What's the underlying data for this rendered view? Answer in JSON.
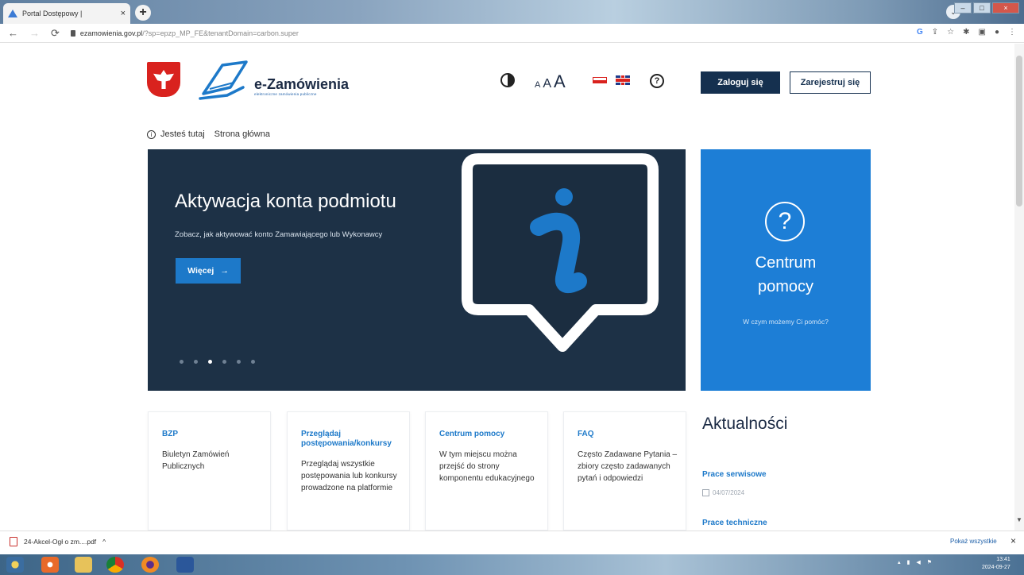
{
  "browser": {
    "tab_title": "Portal Dostępowy |",
    "tab_close": "×",
    "new_tab": "+",
    "url_host": "ezamowienia.gov.pl",
    "url_path": "/?sp=epzp_MP_FE&tenantDomain=carbon.super",
    "win_min": "–",
    "win_max": "□",
    "win_close": "×"
  },
  "header": {
    "brand_name": "e-Zamówienia",
    "brand_tagline": "elektroniczne zamówienia publiczne",
    "font_small": "A",
    "font_medium": "A",
    "font_large": "A",
    "help_glyph": "?",
    "login_label": "Zaloguj się",
    "register_label": "Zarejestruj się"
  },
  "breadcrumb": {
    "info_glyph": "i",
    "prefix": "Jesteś tutaj",
    "current": "Strona główna"
  },
  "hero": {
    "title": "Aktywacja konta podmiotu",
    "subtitle": "Zobacz, jak aktywować konto Zamawiającego lub Wykonawcy",
    "button_label": "Więcej",
    "button_arrow": "→",
    "slides": 6,
    "active_slide": 3
  },
  "help_center": {
    "glyph": "?",
    "title_line1": "Centrum",
    "title_line2": "pomocy",
    "subtitle": "W czym możemy Ci pomóc?"
  },
  "cards": [
    {
      "title": "BZP",
      "desc": "Biuletyn Zamówień Publicznych"
    },
    {
      "title": "Przeglądaj postępowania/konkursy",
      "desc": "Przeglądaj wszystkie postępowania lub konkursy prowadzone na platformie"
    },
    {
      "title": "Centrum pomocy",
      "desc": "W tym miejscu można przejść do strony komponentu edukacyjnego"
    },
    {
      "title": "FAQ",
      "desc": "Często Zadawane Pytania – zbiory często zadawanych pytań i odpowiedzi"
    }
  ],
  "news": {
    "heading": "Aktualności",
    "items": [
      {
        "title": "Prace serwisowe",
        "date": "04/07/2024"
      },
      {
        "title": "Prace techniczne"
      }
    ]
  },
  "downloads": {
    "file_name": "24-Akcel-Ogł o zm....pdf",
    "caret": "^",
    "show_all": "Pokaż wszystkie",
    "close": "×"
  },
  "taskbar": {
    "time": "13:41",
    "date": "2024-09-27"
  },
  "colors": {
    "navy": "#15304f",
    "hero_bg": "#1d3146",
    "accent_blue": "#1d79c9",
    "help_bg": "#1d7ed6"
  }
}
